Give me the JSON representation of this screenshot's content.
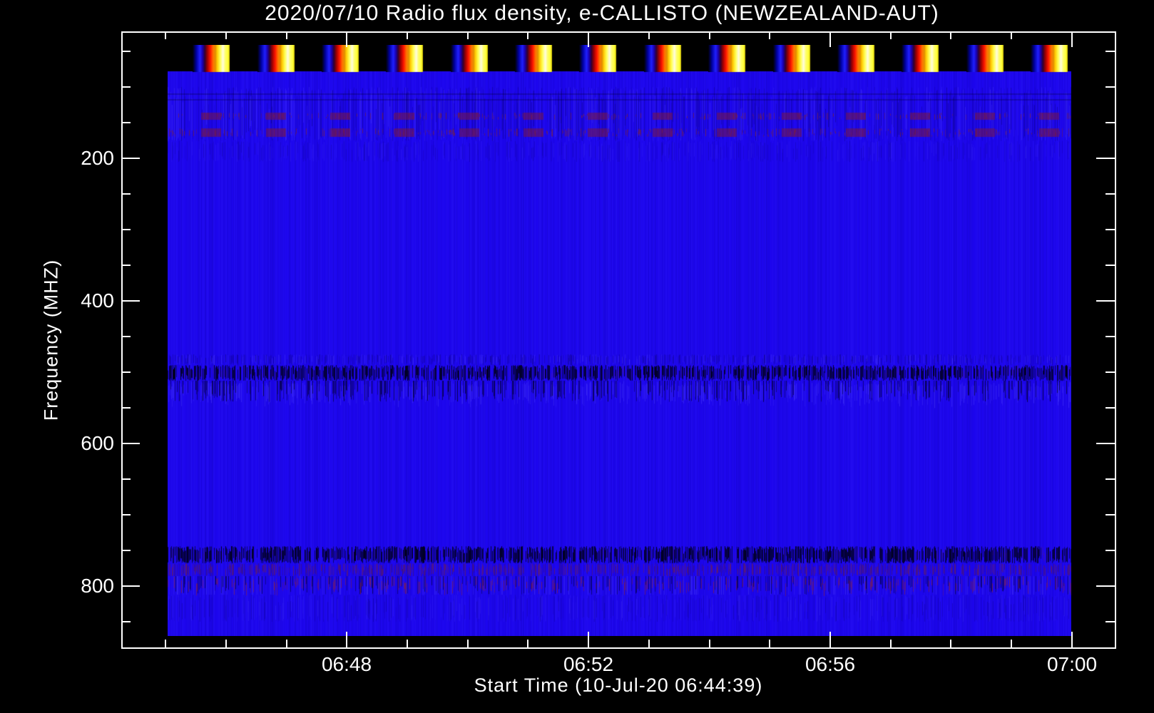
{
  "title": "2020/07/10  Radio flux density, e-CALLISTO (NEWZEALAND-AUT)",
  "axes": {
    "x": {
      "label": "Start Time (10-Jul-20 06:44:39)",
      "frame_start_ut": "06:44:16",
      "frame_end_ut": "07:00:44",
      "minor_tick_interval_s": 60,
      "major_ticks": [
        {
          "time": "06:48:00",
          "label": "06:48"
        },
        {
          "time": "06:52:00",
          "label": "06:52"
        },
        {
          "time": "06:56:00",
          "label": "06:56"
        },
        {
          "time": "07:00:00",
          "label": "07:00"
        }
      ]
    },
    "y": {
      "label": "Frequency (MHZ)",
      "min_mhz": 22,
      "max_mhz": 888,
      "minor_tick_step_mhz": 50,
      "major_ticks": [
        {
          "mhz": 200,
          "label": "200"
        },
        {
          "mhz": 400,
          "label": "400"
        },
        {
          "mhz": 600,
          "label": "600"
        },
        {
          "mhz": 800,
          "label": "800"
        }
      ]
    }
  },
  "chart_data": {
    "type": "heatmap",
    "title": "2020/07/10  Radio flux density, e-CALLISTO (NEWZEALAND-AUT)",
    "xlabel": "Start Time (10-Jul-20 06:44:39)",
    "ylabel": "Frequency (MHZ)",
    "observation": {
      "date": "2020/07/10",
      "network": "e-CALLISTO",
      "station": "NEWZEALAND-AUT",
      "start_time_ut": "06:44:39",
      "end_time_ut": "07:00:00"
    },
    "x_range_ut": [
      "06:44:39",
      "07:00:00"
    ],
    "y_range_mhz": [
      45,
      870
    ],
    "y_axis_inverted": true,
    "grid": false,
    "legend": "none",
    "background_description": "quiet radio background rendered as uniform saturated blue from ~80 to 870 MHz with faint vertical noise striping",
    "colors": {
      "page_background": "#000000",
      "base_blue": "#1d06ee",
      "stripe_dark": "#00002a",
      "stripe_light": "#5a5aff",
      "dash_dark": "#00001e",
      "navy": "#000064",
      "maroon": "#6e1e50",
      "purple": "#4b14d2",
      "dark_red": "#96201e",
      "axis": "#ffffff"
    },
    "noise_seed": 20200710,
    "calibration_bursts": {
      "description": "periodic broadband calibration bursts at lowest frequencies (black-blue-red-yellow-white rainbow columns)",
      "count": 14,
      "freq_range_mhz": [
        41,
        78
      ],
      "first_burst_start_ut": "06:45:27",
      "period_s": 64,
      "duration_s": 37,
      "gradient_stops": [
        [
          0.0,
          "#000000"
        ],
        [
          0.1,
          "#0000a0"
        ],
        [
          0.2,
          "#2020ff"
        ],
        [
          0.27,
          "#1a00b0"
        ],
        [
          0.33,
          "#300030"
        ],
        [
          0.4,
          "#a00000"
        ],
        [
          0.48,
          "#ff1400"
        ],
        [
          0.56,
          "#ff7800"
        ],
        [
          0.62,
          "#e09000"
        ],
        [
          0.66,
          "#ffc800"
        ],
        [
          0.74,
          "#ffff50"
        ],
        [
          0.82,
          "#fffce0"
        ],
        [
          0.88,
          "#ffff70"
        ],
        [
          0.96,
          "#ffff30"
        ],
        [
          1.0,
          "#c8b400"
        ]
      ]
    },
    "interference_bands": [
      {
        "mhz": [
          100,
          176
        ],
        "style": "stripes",
        "density": 0.55,
        "amp": 0.22,
        "appearance": "fine vertical striping"
      },
      {
        "mhz": [
          109,
          111
        ],
        "style": "row",
        "density": 1.0,
        "amp": 0.25,
        "appearance": "continuous darker row"
      },
      {
        "mhz": [
          117,
          119
        ],
        "style": "row",
        "density": 1.0,
        "amp": 0.25,
        "appearance": "continuous darker row"
      },
      {
        "mhz": [
          136,
          146
        ],
        "style": "maroon",
        "density": 0.16,
        "echo": true,
        "appearance": "maroon speckles, echoes under each burst"
      },
      {
        "mhz": [
          158,
          170
        ],
        "style": "maroon",
        "density": 0.2,
        "echo": true,
        "appearance": "maroon speckles, echoes under each burst"
      },
      {
        "mhz": [
          176,
          205
        ],
        "style": "stripes",
        "density": 0.35,
        "amp": 0.12,
        "appearance": "fainter striping"
      },
      {
        "mhz": [
          475,
          490
        ],
        "style": "stripes",
        "density": 0.55,
        "amp": 0.25,
        "appearance": "blue/purple striping"
      },
      {
        "mhz": [
          490,
          512
        ],
        "style": "dashes",
        "density": 0.6,
        "appearance": "dark navy-black dashed interference band"
      },
      {
        "mhz": [
          512,
          542
        ],
        "style": "mixed",
        "density": 0.55,
        "appearance": "mixed bright/dark blue striping"
      },
      {
        "mhz": [
          744,
          768
        ],
        "style": "dashes",
        "density": 0.68,
        "appearance": "strong dark navy-black dashed interference band"
      },
      {
        "mhz": [
          768,
          786
        ],
        "style": "maroon2",
        "density": 0.5,
        "appearance": "maroon/purple speckled band"
      },
      {
        "mhz": [
          786,
          812
        ],
        "style": "mixed2",
        "density": 0.5,
        "appearance": "striping with scattered dark red dashes"
      },
      {
        "mhz": [
          812,
          850
        ],
        "style": "stripes",
        "density": 0.35,
        "amp": 0.15,
        "appearance": "faint striping"
      }
    ],
    "global_stripe_amp": 0.09
  }
}
